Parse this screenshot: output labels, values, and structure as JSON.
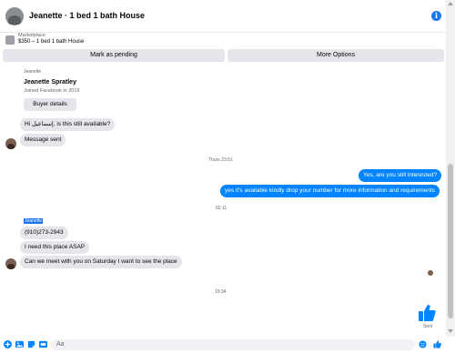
{
  "header": {
    "title": "Jeanette · 1 bed 1 bath House",
    "info_icon": "info-icon",
    "info_glyph": "i"
  },
  "marketplace": {
    "label": "Marketplace",
    "listing": "$350 – 1 bed 1 bath House"
  },
  "actions": {
    "pending_label": "Mark as pending",
    "more_label": "More Options"
  },
  "buyer_card": {
    "sender": "Jeanette",
    "name": "Jeanette Spratley",
    "joined": "Joined Facebook in 2019",
    "button": "Buyer details"
  },
  "messages": {
    "m1": "Hi إسماعيل, is this still available?",
    "m2": "Message sent",
    "ts1": "Thurs 23:51",
    "m3": "Yes, are you still interested?",
    "m4": "yes it's available kindly drop your number for more information and requirements",
    "ts2": "02:11",
    "sender2": "Jeanette",
    "m5": "(910)273-2943",
    "m6": "I need this place ASAP",
    "m7": "Can we meet with you on Saturday I want to see the place",
    "ts3": "19:34",
    "sent_status": "Sent"
  },
  "composer": {
    "placeholder": "Aa",
    "icons": [
      "plus-icon",
      "image-icon",
      "sticker-icon",
      "gif-icon",
      "emoji-icon",
      "thumbs-up-icon"
    ]
  },
  "colors": {
    "accent": "#0084ff",
    "brand": "#1877f2",
    "bubble_in": "#e4e6eb"
  }
}
